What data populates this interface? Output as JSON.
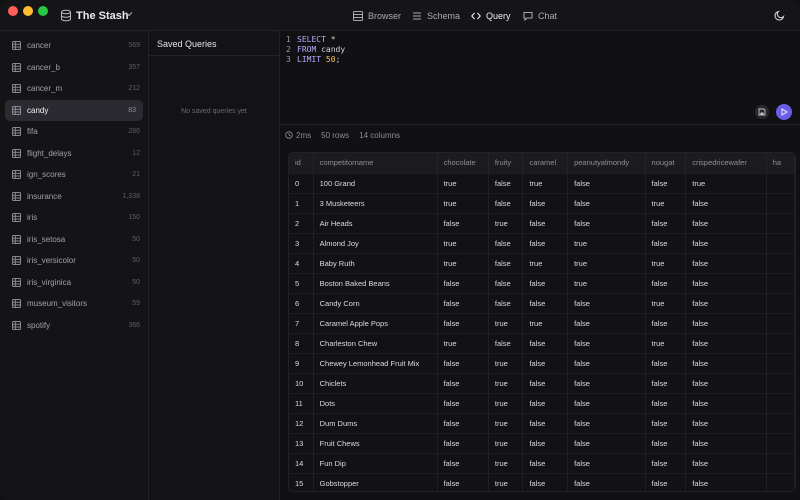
{
  "app": {
    "title": "The Stash",
    "icons": {
      "db": "database-icon",
      "chevron": "chevron-down-icon",
      "theme": "moon-icon"
    }
  },
  "nav": {
    "browser": "Browser",
    "schema": "Schema",
    "query": "Query",
    "chat": "Chat",
    "active": "query"
  },
  "sidebar": {
    "items": [
      {
        "name": "cancer",
        "count": "569"
      },
      {
        "name": "cancer_b",
        "count": "357"
      },
      {
        "name": "cancer_m",
        "count": "212"
      },
      {
        "name": "candy",
        "count": "83"
      },
      {
        "name": "fifa",
        "count": "286"
      },
      {
        "name": "flight_delays",
        "count": "12"
      },
      {
        "name": "ign_scores",
        "count": "21"
      },
      {
        "name": "insurance",
        "count": "1,338"
      },
      {
        "name": "iris",
        "count": "150"
      },
      {
        "name": "iris_setosa",
        "count": "50"
      },
      {
        "name": "iris_versicolor",
        "count": "50"
      },
      {
        "name": "iris_virginica",
        "count": "50"
      },
      {
        "name": "museum_visitors",
        "count": "59"
      },
      {
        "name": "spotify",
        "count": "366"
      }
    ],
    "selected": "candy"
  },
  "saved": {
    "title": "Saved Queries",
    "empty": "No saved queries yet"
  },
  "editor": {
    "lines": [
      {
        "n": "1",
        "kw": "SELECT",
        "rest": " *",
        "num": ""
      },
      {
        "n": "2",
        "kw": "FROM",
        "rest": " candy",
        "num": ""
      },
      {
        "n": "3",
        "kw": "LIMIT",
        "rest": " ",
        "num": "50",
        "tail": ";"
      }
    ]
  },
  "stats": {
    "time": "2ms",
    "rows": "50 rows",
    "cols": "14 columns"
  },
  "results": {
    "columns": [
      "id",
      "competitorname",
      "chocolate",
      "fruity",
      "caramel",
      "peanutyalmondy",
      "nougat",
      "crispedricewafer",
      "ha"
    ],
    "rows": [
      [
        "0",
        "100 Grand",
        "true",
        "false",
        "true",
        "false",
        "false",
        "true"
      ],
      [
        "1",
        "3 Musketeers",
        "true",
        "false",
        "false",
        "false",
        "true",
        "false"
      ],
      [
        "2",
        "Air Heads",
        "false",
        "true",
        "false",
        "false",
        "false",
        "false"
      ],
      [
        "3",
        "Almond Joy",
        "true",
        "false",
        "false",
        "true",
        "false",
        "false"
      ],
      [
        "4",
        "Baby Ruth",
        "true",
        "false",
        "true",
        "true",
        "true",
        "false"
      ],
      [
        "5",
        "Boston Baked Beans",
        "false",
        "false",
        "false",
        "true",
        "false",
        "false"
      ],
      [
        "6",
        "Candy Corn",
        "false",
        "false",
        "false",
        "false",
        "true",
        "false"
      ],
      [
        "7",
        "Caramel Apple Pops",
        "false",
        "true",
        "true",
        "false",
        "false",
        "false"
      ],
      [
        "8",
        "Charleston Chew",
        "true",
        "false",
        "false",
        "false",
        "true",
        "false"
      ],
      [
        "9",
        "Chewey Lemonhead Fruit Mix",
        "false",
        "true",
        "false",
        "false",
        "false",
        "false"
      ],
      [
        "10",
        "Chiclets",
        "false",
        "true",
        "false",
        "false",
        "false",
        "false"
      ],
      [
        "11",
        "Dots",
        "false",
        "true",
        "false",
        "false",
        "false",
        "false"
      ],
      [
        "12",
        "Dum Dums",
        "false",
        "true",
        "false",
        "false",
        "false",
        "false"
      ],
      [
        "13",
        "Fruit Chews",
        "false",
        "true",
        "false",
        "false",
        "false",
        "false"
      ],
      [
        "14",
        "Fun Dip",
        "false",
        "true",
        "false",
        "false",
        "false",
        "false"
      ],
      [
        "15",
        "Gobstopper",
        "false",
        "true",
        "false",
        "false",
        "false",
        "false"
      ]
    ]
  }
}
